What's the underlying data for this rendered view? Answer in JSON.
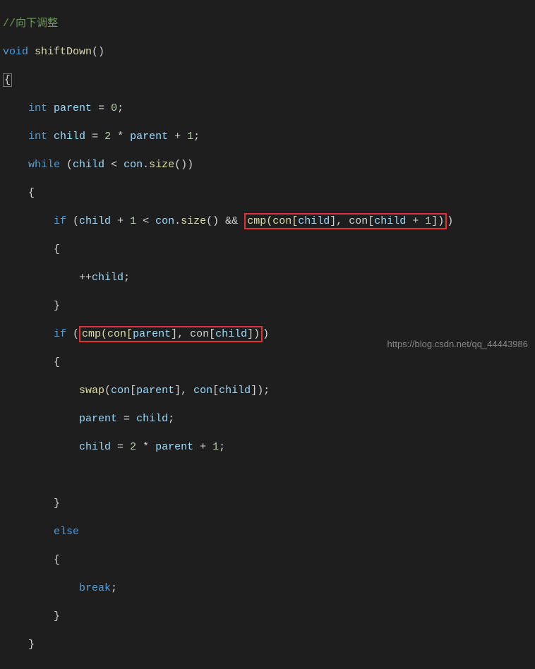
{
  "comment": "//向下调整",
  "sig_void": "void",
  "sig_name": "shiftDown",
  "sig_parens": "()",
  "brace_open_1": "{",
  "decl1_int": "int",
  "decl1_var": "parent",
  "decl1_eq": " = ",
  "decl1_val": "0",
  "decl1_semi": ";",
  "decl2_int": "int",
  "decl2_var": "child",
  "decl2_eq": " = ",
  "decl2_2": "2",
  "decl2_star": " * ",
  "decl2_parent": "parent",
  "decl2_plus": " + ",
  "decl2_1": "1",
  "decl2_semi": ";",
  "while_kw": "while",
  "while_open": " (",
  "while_child": "child",
  "while_lt": " < ",
  "while_con": "con",
  "while_dot": ".",
  "while_size": "size",
  "while_par": "()",
  "while_close": ")",
  "brace_open_2": "{",
  "if1_kw": "if",
  "if1_open": " (",
  "if1_child": "child",
  "if1_plus": " + ",
  "if1_1": "1",
  "if1_lt": " < ",
  "if1_con": "con",
  "if1_dot": ".",
  "if1_size": "size",
  "if1_par": "()",
  "if1_and": " && ",
  "if1_cmp_call": "cmp(con[",
  "if1_cmp_child1": "child",
  "if1_cmp_mid": "], con[",
  "if1_cmp_child2": "child",
  "if1_cmp_plus": " + ",
  "if1_cmp_1": "1",
  "if1_cmp_end": "])",
  "if1_close": ")",
  "brace_open_3": "{",
  "inc_line": "++",
  "inc_var": "child",
  "inc_semi": ";",
  "brace_close_3": "}",
  "if2_kw": "if",
  "if2_open": " (",
  "if2_cmp_call": "cmp(con[",
  "if2_cmp_parent": "parent",
  "if2_cmp_mid": "], con[",
  "if2_cmp_child": "child",
  "if2_cmp_end": "])",
  "if2_close": ")",
  "brace_open_4": "{",
  "swap_call": "swap",
  "swap_open": "(",
  "swap_con1": "con",
  "swap_br1o": "[",
  "swap_parent1": "parent",
  "swap_br1c": "]",
  "swap_comma": ", ",
  "swap_con2": "con",
  "swap_br2o": "[",
  "swap_child2": "child",
  "swap_br2c": "]",
  "swap_close": ")",
  "swap_semi": ";",
  "assign1_parent": "parent",
  "assign1_eq": " = ",
  "assign1_child": "child",
  "assign1_semi": ";",
  "assign2_child": "child",
  "assign2_eq": " = ",
  "assign2_2": "2",
  "assign2_star": " * ",
  "assign2_parent": "parent",
  "assign2_plus": " + ",
  "assign2_1": "1",
  "assign2_semi": ";",
  "brace_close_4": "}",
  "else_kw": "else",
  "brace_open_5": "{",
  "break_kw": "break",
  "break_semi": ";",
  "brace_close_5": "}",
  "brace_close_2": "}",
  "watermark": "https://blog.csdn.net/qq_44443986"
}
